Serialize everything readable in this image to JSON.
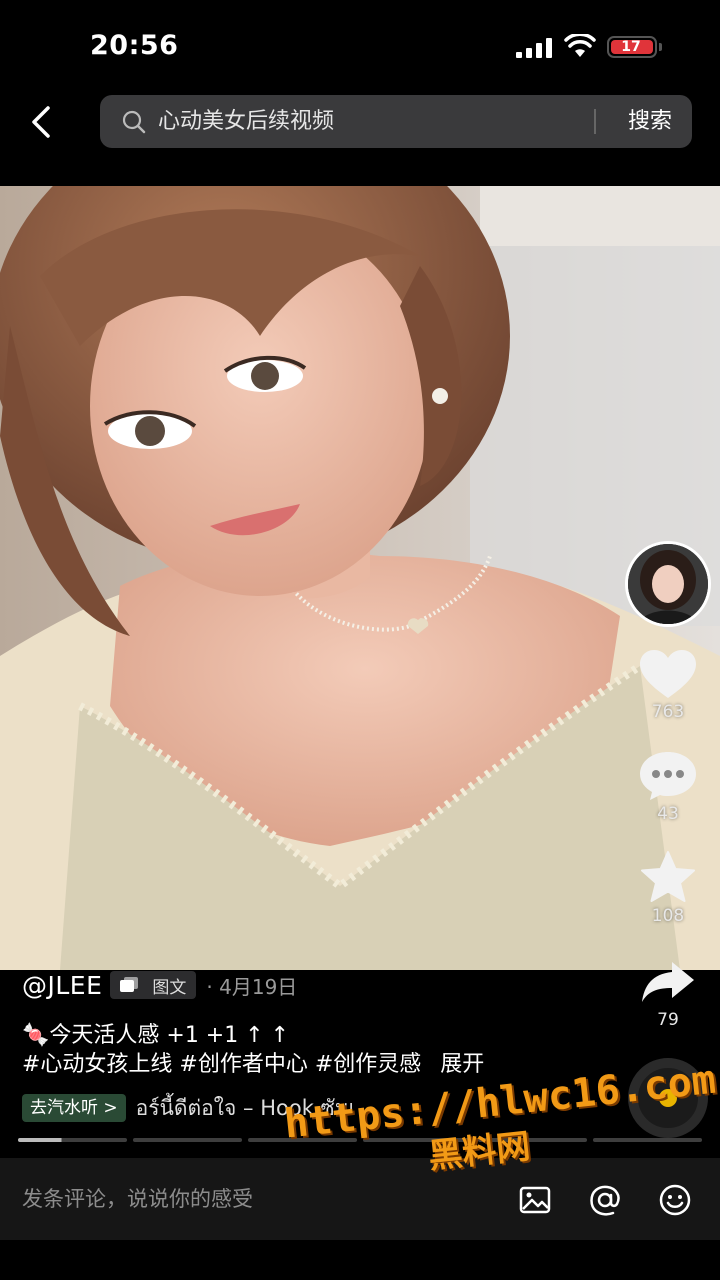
{
  "status_bar": {
    "time": "20:56",
    "battery": "17",
    "battery_color": "#e0343a"
  },
  "header": {
    "back_icon": "chevron-left-icon",
    "search_query": "心动美女后续视频",
    "search_button": "搜索"
  },
  "post": {
    "author": "@JLEE",
    "type_badge": "图文",
    "date": "· 4月19日",
    "caption_line1": "🍬今天活人感 +1 +1 ↑ ↑",
    "caption_line2": "#心动女孩上线 #创作者中心 #创作灵感",
    "expand": "展开",
    "listen_chip": "去汽水听 >",
    "music_title": "อร์นี้ดีต่อใจ – Hook   ซัมเ"
  },
  "actions": {
    "likes": "763",
    "comments": "43",
    "favorites": "108",
    "shares": "79"
  },
  "progress": {
    "segments": 6,
    "active_index": 0
  },
  "comment_bar": {
    "placeholder": "发条评论，说说你的感受"
  },
  "watermark": {
    "url": "https://hlwc16.com",
    "brand": "黑料网",
    "color": "#f29a16"
  }
}
